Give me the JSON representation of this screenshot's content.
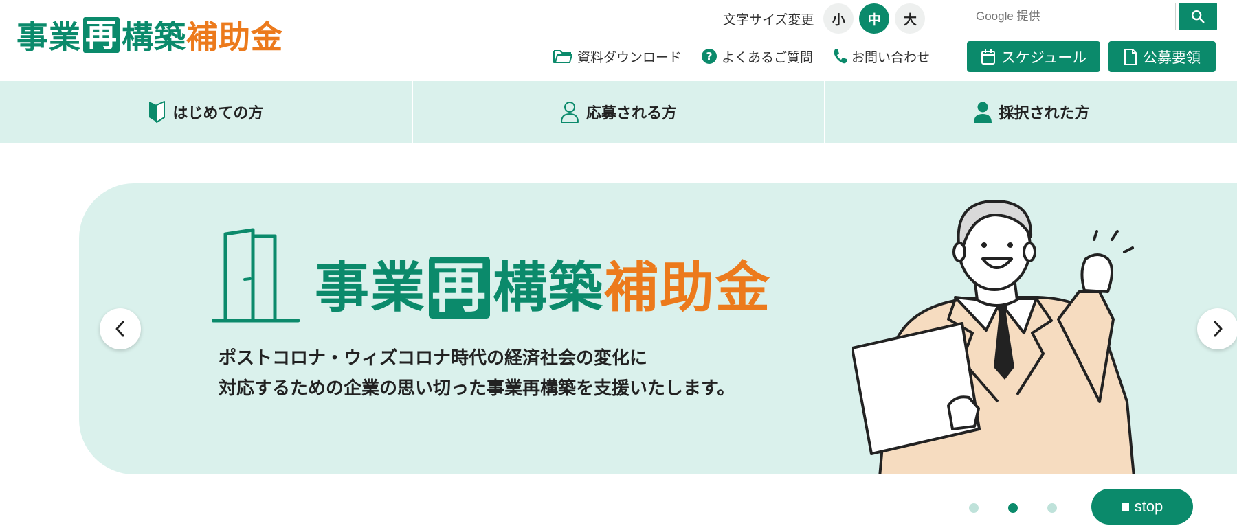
{
  "logo": {
    "part1": "事業",
    "part2": "再",
    "part3": "構築",
    "part4": "補助金"
  },
  "font_size": {
    "label": "文字サイズ変更",
    "options": [
      {
        "label": "小"
      },
      {
        "label": "中",
        "active": true
      },
      {
        "label": "大"
      }
    ]
  },
  "search": {
    "placeholder": "Google 提供"
  },
  "util_links": {
    "downloads": "資料ダウンロード",
    "faq": "よくあるご質問",
    "contact": "お問い合わせ"
  },
  "header_buttons": {
    "schedule": "スケジュール",
    "guidelines": "公募要領"
  },
  "nav": {
    "items": [
      {
        "label": "はじめての方",
        "icon": "beginner-leaf-icon"
      },
      {
        "label": "応募される方",
        "icon": "person-outline-icon"
      },
      {
        "label": "採択された方",
        "icon": "person-filled-icon"
      }
    ]
  },
  "hero": {
    "title_part1": "事業",
    "title_part2": "再",
    "title_part3": "構築",
    "title_part4": "補助金",
    "tagline_line1": "ポストコロナ・ウィズコロナ時代の経済社会の変化に",
    "tagline_line2": "対応するための企業の思い切った事業再構築を支援いたします。"
  },
  "slider": {
    "slide_count": 3,
    "active_slide": 2,
    "stop_label": "stop"
  },
  "colors": {
    "brand_green": "#0b8a6b",
    "brand_orange": "#ec7a1c",
    "nav_bg": "#daf1ec"
  }
}
